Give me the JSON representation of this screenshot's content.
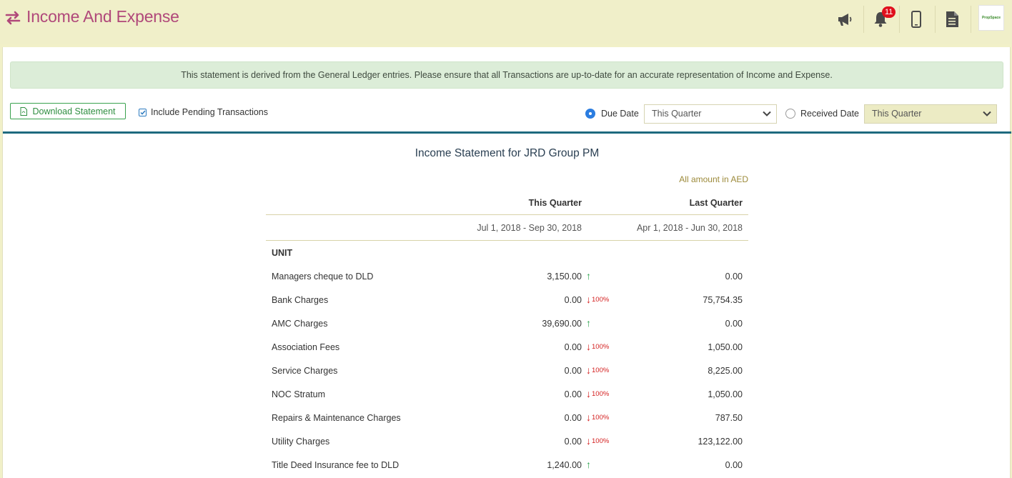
{
  "header": {
    "title": "Income And Expense",
    "notification_count": "11",
    "logo_text": "PropSpace"
  },
  "notice": "This statement is derived from the General Ledger entries. Please ensure that all Transactions are up-to-date for an accurate representation of Income and Expense.",
  "toolbar": {
    "download_label": "Download Statement",
    "include_pending_label": "Include Pending Transactions",
    "include_pending_checked": true,
    "due_date_label": "Due Date",
    "due_date_selected": true,
    "due_date_value": "This Quarter",
    "received_date_label": "Received Date",
    "received_date_selected": false,
    "received_date_value": "This Quarter"
  },
  "statement": {
    "title": "Income Statement for JRD Group PM",
    "currency_note": "All amount in AED",
    "col_current": "This Quarter",
    "col_previous": "Last Quarter",
    "range_current": "Jul 1, 2018 - Sep 30, 2018",
    "range_previous": "Apr 1, 2018 - Jun 30, 2018",
    "section": "UNIT",
    "rows": [
      {
        "name": "Managers cheque to DLD",
        "current": "3,150.00",
        "trend": "up",
        "pct": "",
        "previous": "0.00"
      },
      {
        "name": "Bank Charges",
        "current": "0.00",
        "trend": "down",
        "pct": "100%",
        "previous": "75,754.35"
      },
      {
        "name": "AMC Charges",
        "current": "39,690.00",
        "trend": "up",
        "pct": "",
        "previous": "0.00"
      },
      {
        "name": "Association Fees",
        "current": "0.00",
        "trend": "down",
        "pct": "100%",
        "previous": "1,050.00"
      },
      {
        "name": "Service Charges",
        "current": "0.00",
        "trend": "down",
        "pct": "100%",
        "previous": "8,225.00"
      },
      {
        "name": "NOC Stratum",
        "current": "0.00",
        "trend": "down",
        "pct": "100%",
        "previous": "1,050.00"
      },
      {
        "name": "Repairs & Maintenance Charges",
        "current": "0.00",
        "trend": "down",
        "pct": "100%",
        "previous": "787.50"
      },
      {
        "name": "Utility Charges",
        "current": "0.00",
        "trend": "down",
        "pct": "100%",
        "previous": "123,122.00"
      },
      {
        "name": "Title Deed Insurance fee to DLD",
        "current": "1,240.00",
        "trend": "up",
        "pct": "",
        "previous": "0.00"
      }
    ]
  },
  "colors": {
    "title": "#b0487a",
    "accent_rule": "#1e6a7f",
    "trend_up": "#2aa24c",
    "trend_down": "#d42020"
  }
}
